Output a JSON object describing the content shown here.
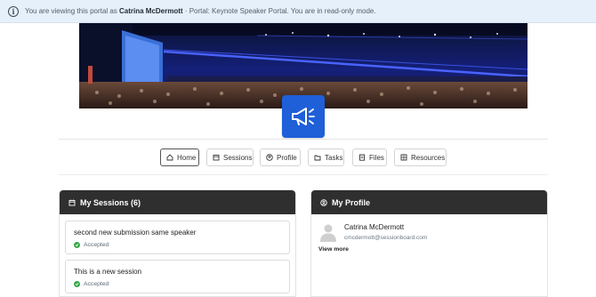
{
  "notice": {
    "prefix": "You are viewing this portal as",
    "user_name": "Catrina McDermott",
    "suffix": "· Portal: Keynote Speaker Portal. You are in read-only mode."
  },
  "nav": [
    {
      "label": "Home",
      "icon": "home-icon",
      "active": true
    },
    {
      "label": "Sessions",
      "icon": "calendar-icon"
    },
    {
      "label": "Profile",
      "icon": "user-circle-icon"
    },
    {
      "label": "Tasks",
      "icon": "folder-icon"
    },
    {
      "label": "Files",
      "icon": "file-icon"
    },
    {
      "label": "Resources",
      "icon": "grid-icon"
    }
  ],
  "sessions_panel": {
    "title": "My Sessions (6)",
    "items": [
      {
        "title": "second new submission same speaker",
        "status": "Accepted"
      },
      {
        "title": "This is a new session",
        "status": "Accepted"
      }
    ]
  },
  "profile_panel": {
    "title": "My Profile",
    "name": "Catrina McDermott",
    "email": "cmcdermott@sessionboard.com",
    "view_more": "View more"
  },
  "colors": {
    "notice_bg": "#e6f0fa",
    "logo_bg": "#1f5fd8",
    "panel_header_bg": "#2f2f2f",
    "accepted_green": "#37a845"
  }
}
